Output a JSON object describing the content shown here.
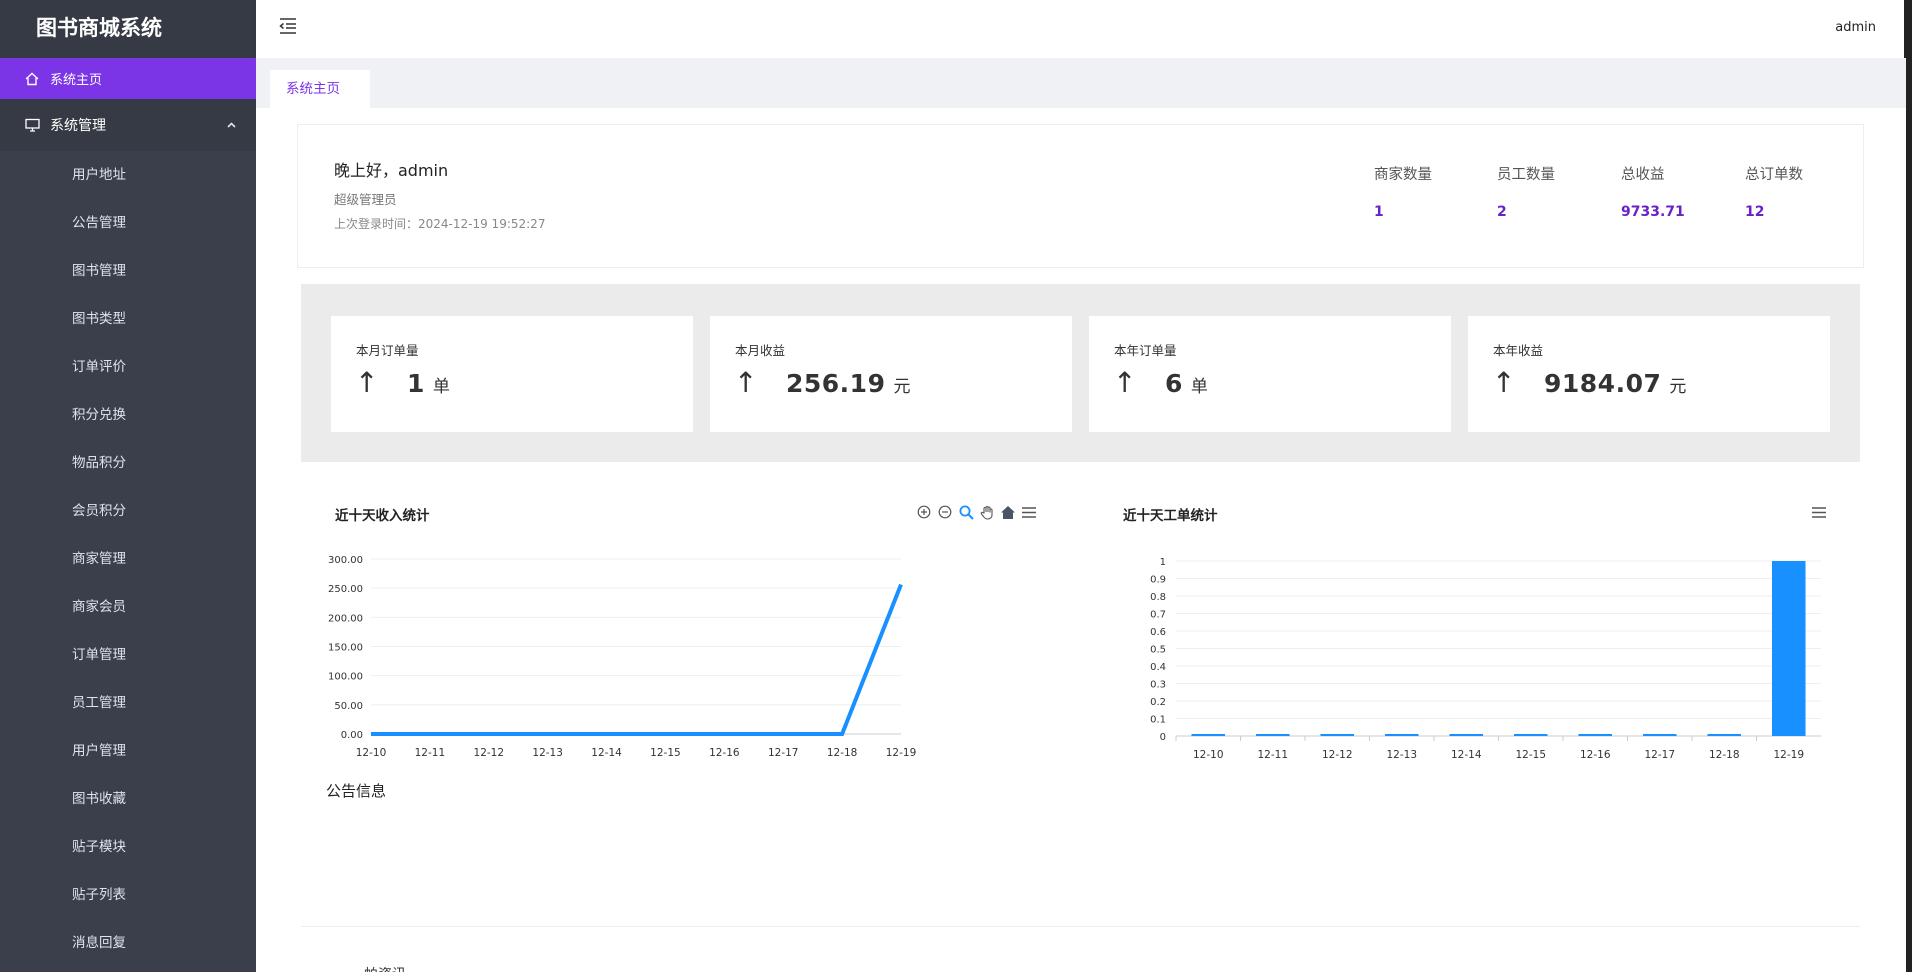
{
  "brand": "图书商城系统",
  "sidebar": {
    "home": {
      "label": "系统主页",
      "icon": "home-icon"
    },
    "group": {
      "label": "系统管理",
      "icon": "monitor-icon",
      "expanded": true
    },
    "items": [
      {
        "label": "用户地址"
      },
      {
        "label": "公告管理"
      },
      {
        "label": "图书管理"
      },
      {
        "label": "图书类型"
      },
      {
        "label": "订单评价"
      },
      {
        "label": "积分兑换"
      },
      {
        "label": "物品积分"
      },
      {
        "label": "会员积分"
      },
      {
        "label": "商家管理"
      },
      {
        "label": "商家会员"
      },
      {
        "label": "订单管理"
      },
      {
        "label": "员工管理"
      },
      {
        "label": "用户管理"
      },
      {
        "label": "图书收藏"
      },
      {
        "label": "贴子模块"
      },
      {
        "label": "贴子列表"
      },
      {
        "label": "消息回复"
      }
    ]
  },
  "header": {
    "user": "admin"
  },
  "tabs": [
    {
      "label": "系统主页",
      "active": true
    }
  ],
  "welcome": {
    "greeting": "晚上好，admin",
    "role": "超级管理员",
    "last_login": "上次登录时间：2024-12-19 19:52:27",
    "stats": [
      {
        "label": "商家数量",
        "value": "1"
      },
      {
        "label": "员工数量",
        "value": "2"
      },
      {
        "label": "总收益",
        "value": "9733.71"
      },
      {
        "label": "总订单数",
        "value": "12"
      }
    ]
  },
  "kpis": [
    {
      "title": "本月订单量",
      "arrow": "↑",
      "value": "1",
      "unit": "单"
    },
    {
      "title": "本月收益",
      "arrow": "↑",
      "value": "256.19",
      "unit": "元"
    },
    {
      "title": "本年订单量",
      "arrow": "↑",
      "value": "6",
      "unit": "单"
    },
    {
      "title": "本年收益",
      "arrow": "↑",
      "value": "9184.07",
      "unit": "元"
    }
  ],
  "colors": {
    "accent": "#7b35e6",
    "sidebar": "#3a3f4b",
    "series": "#1890ff",
    "stat_value": "#6a22c8"
  },
  "chart_data": [
    {
      "type": "line",
      "title": "近十天收入统计",
      "categories": [
        "12-10",
        "12-11",
        "12-12",
        "12-13",
        "12-14",
        "12-15",
        "12-16",
        "12-17",
        "12-18",
        "12-19"
      ],
      "values": [
        0,
        0,
        0,
        0,
        0,
        0,
        0,
        0,
        0,
        256.19
      ],
      "yticks": [
        "0.00",
        "50.00",
        "100.00",
        "150.00",
        "200.00",
        "250.00",
        "300.00"
      ],
      "ylim": [
        0,
        300
      ],
      "grid": true,
      "toolbar": [
        "zoom-in-icon",
        "zoom-out-icon",
        "search-zoom-icon",
        "pan-hand-icon",
        "home-reset-icon",
        "menu-icon"
      ]
    },
    {
      "type": "bar",
      "title": "近十天工单统计",
      "categories": [
        "12-10",
        "12-11",
        "12-12",
        "12-13",
        "12-14",
        "12-15",
        "12-16",
        "12-17",
        "12-18",
        "12-19"
      ],
      "values": [
        0,
        0,
        0,
        0,
        0,
        0,
        0,
        0,
        0,
        1
      ],
      "yticks": [
        "0",
        "0.1",
        "0.2",
        "0.3",
        "0.4",
        "0.5",
        "0.6",
        "0.7",
        "0.8",
        "0.9",
        "1"
      ],
      "ylim": [
        0,
        1
      ],
      "grid": true,
      "toolbar": [
        "menu-icon"
      ]
    }
  ],
  "notice": {
    "title": "公告信息",
    "first_item": "帕资讯"
  }
}
